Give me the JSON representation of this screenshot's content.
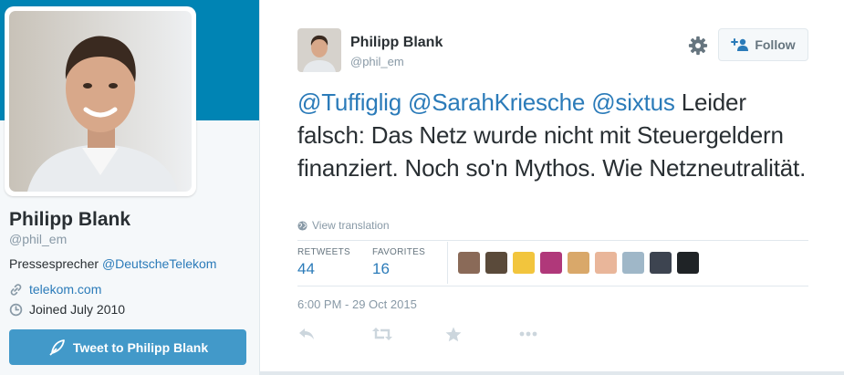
{
  "profile": {
    "name": "Philipp Blank",
    "handle": "@phil_em",
    "bio_text": "Pressesprecher ",
    "bio_mention": "@DeutscheTelekom",
    "url": "telekom.com",
    "joined": "Joined July 2010",
    "tweet_to_label": "Tweet to Philipp Blank"
  },
  "tweet": {
    "author_name": "Philipp Blank",
    "author_handle": "@phil_em",
    "follow_label": "Follow",
    "mentions": [
      "@Tuffiglig",
      "@SarahKriesche",
      "@sixtus"
    ],
    "body": "Leider falsch: Das Netz wurde nicht mit Steuergeldern finanziert. Noch so'n Mythos. Wie Netzneutralität.",
    "view_translation": "View translation",
    "retweets_label": "RETWEETS",
    "retweets_count": "44",
    "favorites_label": "FAVORITES",
    "favorites_count": "16",
    "timestamp": "6:00 PM - 29 Oct 2015"
  },
  "favoriters": [
    {
      "icon": "user-avatar",
      "color": "#8a6a58"
    },
    {
      "icon": "user-avatar",
      "color": "#5a4a3a"
    },
    {
      "icon": "simpsons-avatar",
      "color": "#f2c53d"
    },
    {
      "icon": "user-avatar",
      "color": "#b0387a"
    },
    {
      "icon": "user-avatar",
      "color": "#d9a86a"
    },
    {
      "icon": "user-avatar",
      "color": "#e9b69a"
    },
    {
      "icon": "robot-avatar",
      "color": "#9fb7c8"
    },
    {
      "icon": "user-avatar",
      "color": "#3d4450"
    },
    {
      "icon": "user-avatar",
      "color": "#1f2326"
    }
  ],
  "colors": {
    "banner": "#0084b4",
    "link": "#2b7bb9",
    "tweet_button": "#4299c9",
    "muted": "#8899a6"
  }
}
